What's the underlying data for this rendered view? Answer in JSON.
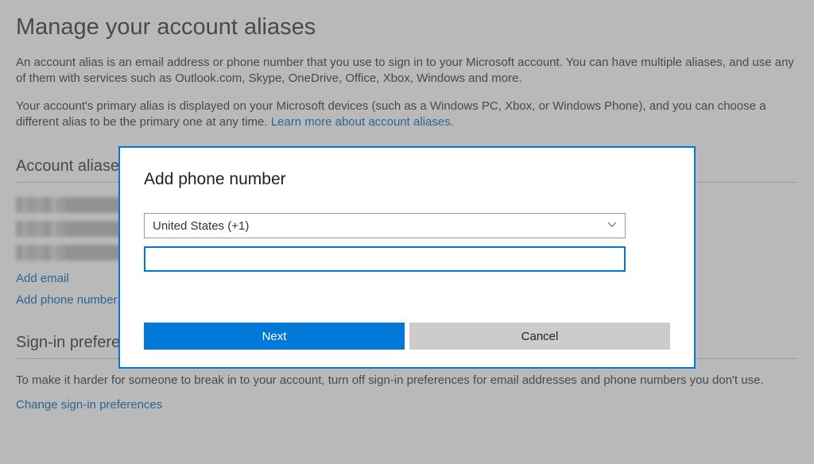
{
  "page": {
    "title": "Manage your account aliases",
    "intro1_a": "An account alias is an email address or phone number that you use to sign in to your Microsoft account. You can have multiple aliases, and use any of them with services such as Outlook.com, Skype, OneDrive, Office, Xbox, Windows and more.",
    "intro2_a": "Your account's primary alias is displayed on your Microsoft devices (such as a Windows PC, Xbox, or Windows Phone), and you can choose a different alias to be the primary one at any time. ",
    "learn_link": "Learn more about account aliases."
  },
  "aliases": {
    "section_title": "Account aliases",
    "add_email": "Add email",
    "add_phone": "Add phone number"
  },
  "signin": {
    "section_title": "Sign-in preferences",
    "desc": "To make it harder for someone to break in to your account, turn off sign-in preferences for email addresses and phone numbers you don't use.",
    "change_link": "Change sign-in preferences"
  },
  "modal": {
    "title": "Add phone number",
    "country_selected": "United States (+1)",
    "phone_value": "",
    "next": "Next",
    "cancel": "Cancel"
  }
}
